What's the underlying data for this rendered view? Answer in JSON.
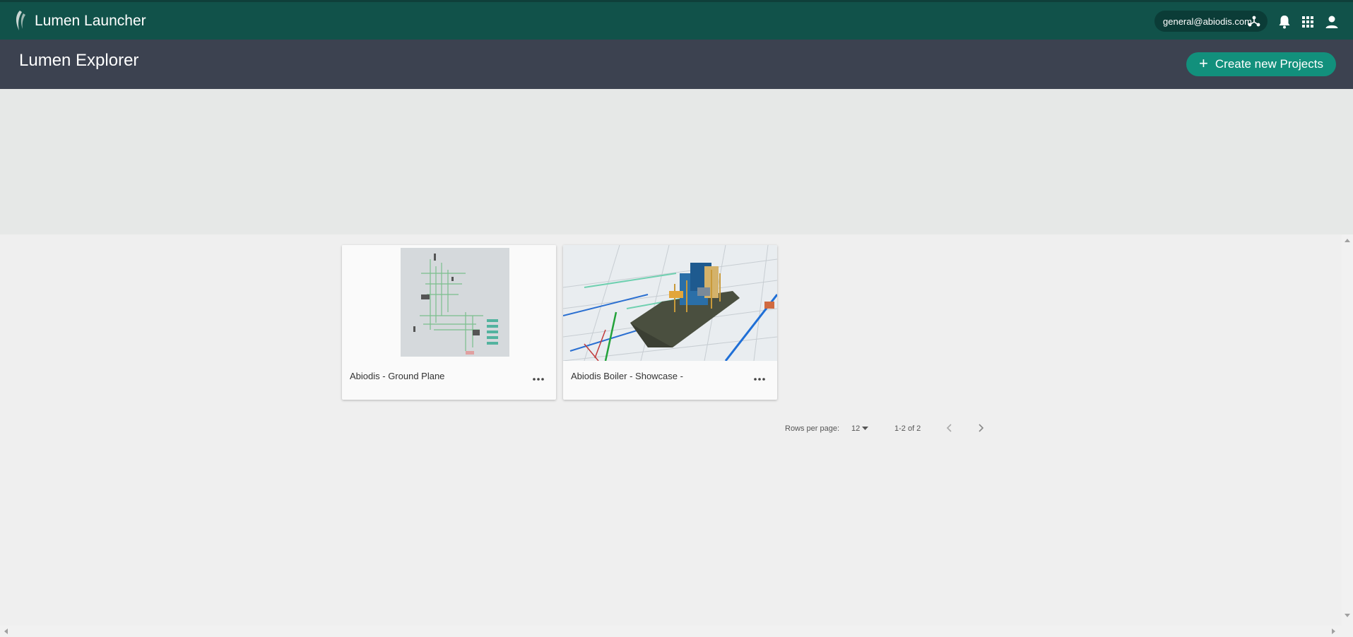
{
  "app": {
    "title": "Lumen Launcher"
  },
  "account": {
    "email": "general@abiodis.com"
  },
  "icons": {
    "logo": "leaf-logo-icon",
    "hub": "hub-icon",
    "notifications": "bell-icon",
    "apps": "apps-grid-icon",
    "user": "person-icon",
    "more": "more-horizontal-icon",
    "prev": "chevron-left-icon",
    "next": "chevron-right-icon"
  },
  "subheader": {
    "title": "Lumen Explorer",
    "create_label": "Create new Projects",
    "create_icon": "+"
  },
  "projects": [
    {
      "title": "Abiodis - Ground Plane"
    },
    {
      "title": "Abiodis Boiler - Showcase -"
    }
  ],
  "pagination": {
    "rows_label": "Rows per page:",
    "rows_value": "12",
    "range": "1-2 of 2"
  },
  "colors": {
    "topbar": "#11524a",
    "subheader": "#3c4250",
    "accent": "#12907c",
    "banner": "#e6e8e7",
    "background": "#efefef"
  }
}
